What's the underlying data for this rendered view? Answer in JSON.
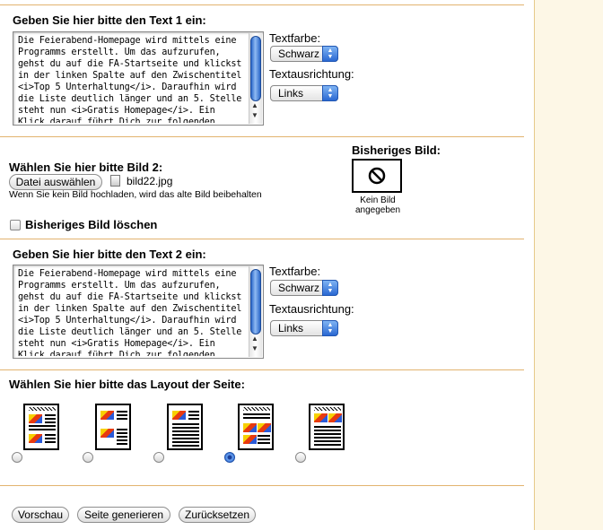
{
  "text1": {
    "heading": "Geben Sie hier bitte den Text 1 ein:",
    "content": "Die Feierabend-Homepage wird mittels eine Programms erstellt. Um das aufzurufen, gehst du auf die FA-Startseite und klickst in der linken Spalte auf den Zwischentitel <i>Top 5 Unterhaltung</i>. Daraufhin wird die Liste deutlich länger und an 5. Stelle steht nun <i>Gratis Homepage</i>. Ein Klick darauf führt Dich zur folgenden Abbildung oder klick",
    "color_label": "Textfarbe:",
    "color_value": "Schwarz",
    "align_label": "Textausrichtung:",
    "align_value": "Links"
  },
  "image2": {
    "heading": "Wählen Sie hier bitte Bild 2:",
    "choose_button": "Datei auswählen",
    "file_name": "bild22.jpg",
    "hint": "Wenn Sie kein Bild hochladen, wird das alte Bild beibehalten",
    "previous_label": "Bisheriges Bild:",
    "no_image_text": "Kein Bild angegeben",
    "delete_label": "Bisheriges Bild löschen"
  },
  "text2": {
    "heading": "Geben Sie hier bitte den Text 2 ein:",
    "content": "Die Feierabend-Homepage wird mittels eine Programms erstellt. Um das aufzurufen, gehst du auf die FA-Startseite und klickst in der linken Spalte auf den Zwischentitel <i>Top 5 Unterhaltung</i>. Daraufhin wird die Liste deutlich länger und an 5. Stelle steht nun <i>Gratis Homepage</i>. Ein Klick darauf führt Dich zur folgenden Abbildung oder klick",
    "color_label": "Textfarbe:",
    "color_value": "Schwarz",
    "align_label": "Textausrichtung:",
    "align_value": "Links"
  },
  "layout": {
    "heading": "Wählen Sie hier bitte das Layout der Seite:",
    "selected_index": 3
  },
  "actions": {
    "preview": "Vorschau",
    "generate": "Seite generieren",
    "reset": "Zurücksetzen"
  },
  "colors": {
    "divider": "#e2b36f",
    "side_panel": "#fdf7e6",
    "accent_blue": "#2a68d2"
  }
}
